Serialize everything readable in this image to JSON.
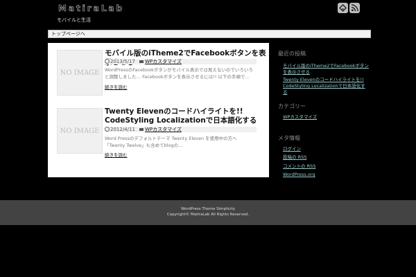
{
  "header": {
    "site_title": "MatiraLab",
    "site_description": "モバイルと生活",
    "icons": [
      "feedly-icon",
      "rss-icon"
    ]
  },
  "nav": {
    "home_label": "トップページへ"
  },
  "posts": [
    {
      "thumbnail_text": "NO IMAGE",
      "title": "モバイル版のiTheme2でFacebookボタンを表示させる",
      "date": "2013/5/17",
      "category": "WPカスタマイズ",
      "excerpt": "WordPressのFacebookボタンがモバイル表示では見えないのでいろいろと調整しました… Facebookボタンを表示させるには!! 以下の手順で…",
      "more": "続きを読む"
    },
    {
      "thumbnail_text": "NO IMAGE",
      "title": "Twenty Elevenのコードハイライトを!! CodeStyling Localizationで日本語化する",
      "date": "2012/4/11",
      "category": "WPカスタマイズ",
      "excerpt": "Word Pressのデフォルトテーマ Twenty Eleven を使用中の方へ 「Twenty Twelve」も含めてblogの…",
      "more": "続きを読む"
    }
  ],
  "sidebar": {
    "recent_title": "最近の投稿",
    "recent_items": [
      "モバイル版のiTheme2でFacebookボタンを表示させる",
      "Twenty Elevenのコードハイライトを!! CodeStyling Localizationで日本語化する"
    ],
    "categories_title": "カテゴリー",
    "categories": [
      "WPカスタマイズ"
    ],
    "meta_title": "メタ情報",
    "meta_items": [
      "ログイン",
      "投稿の RSS",
      "コメントの RSS",
      "WordPress.org"
    ]
  },
  "footer": {
    "line1": "WordPress Theme Simplicity",
    "line2": "Copyright© MatiraLab All Rights Reserved."
  }
}
